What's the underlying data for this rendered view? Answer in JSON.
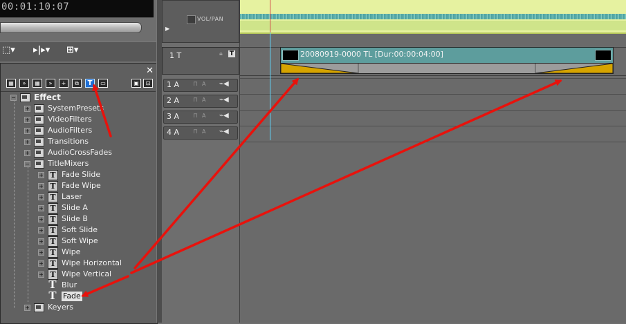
{
  "monitor": {
    "timecode": "00:01:10:07"
  },
  "effect_panel": {
    "close_label": "✕",
    "tree": [
      {
        "label": "Effect",
        "type": "folder",
        "level": 0,
        "expanded": true,
        "bold": true
      },
      {
        "label": "SystemPresets",
        "type": "folder",
        "level": 1
      },
      {
        "label": "VideoFilters",
        "type": "folder",
        "level": 1
      },
      {
        "label": "AudioFilters",
        "type": "folder",
        "level": 1
      },
      {
        "label": "Transitions",
        "type": "folder",
        "level": 1
      },
      {
        "label": "AudioCrossFades",
        "type": "folder",
        "level": 1
      },
      {
        "label": "TitleMixers",
        "type": "folder",
        "level": 1,
        "expanded": true
      },
      {
        "label": "Fade Slide",
        "type": "title",
        "level": 2
      },
      {
        "label": "Fade Wipe",
        "type": "title",
        "level": 2
      },
      {
        "label": "Laser",
        "type": "title",
        "level": 2
      },
      {
        "label": "Slide A",
        "type": "title",
        "level": 2
      },
      {
        "label": "Slide B",
        "type": "title",
        "level": 2
      },
      {
        "label": "Soft Slide",
        "type": "title",
        "level": 2
      },
      {
        "label": "Soft Wipe",
        "type": "title",
        "level": 2
      },
      {
        "label": "Wipe",
        "type": "title",
        "level": 2
      },
      {
        "label": "Wipe Horizontal",
        "type": "title",
        "level": 2
      },
      {
        "label": "Wipe Vertical",
        "type": "title",
        "level": 2
      },
      {
        "label": "Blur",
        "type": "title-plain",
        "level": 2
      },
      {
        "label": "Fade",
        "type": "title-plain",
        "level": 2,
        "selected": true
      },
      {
        "label": "Keyers",
        "type": "folder",
        "level": 1
      }
    ]
  },
  "tracks": {
    "vol_label": "VOL/PAN",
    "title_track": "1 T",
    "audio": [
      "1 A",
      "2 A",
      "3 A",
      "4 A"
    ]
  },
  "timeline": {
    "clip_label": "20080919-0000  TL [Dur:00:00:04:00]"
  },
  "colors": {
    "arrow": "#e8120c",
    "clip": "#5d9d9d",
    "fx_ramp": "#d6a400",
    "audio_bg": "#e6f2a0"
  }
}
